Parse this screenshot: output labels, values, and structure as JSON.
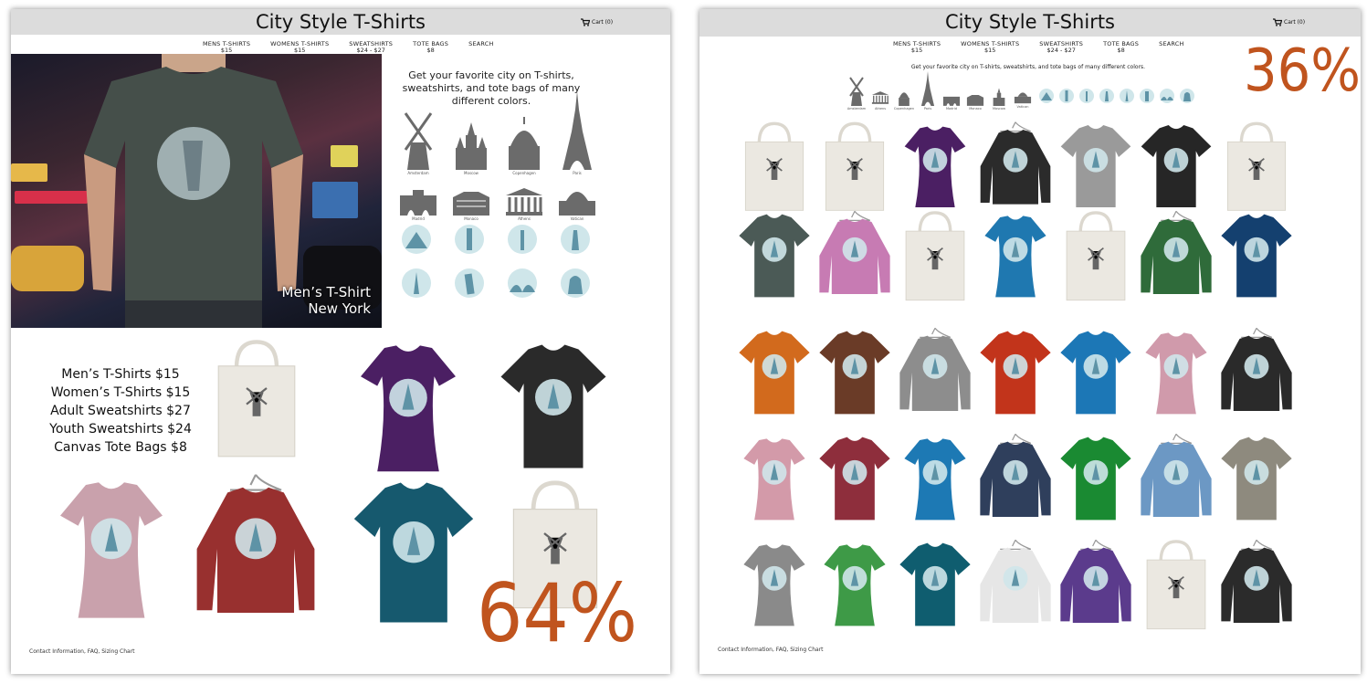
{
  "left": {
    "header": {
      "title": "City Style T-Shirts",
      "cart_label": "Cart (0)"
    },
    "nav": [
      {
        "label": "MENS T-SHIRTS",
        "price": "$15"
      },
      {
        "label": "WOMENS T-SHIRTS",
        "price": "$15"
      },
      {
        "label": "SWEATSHIRTS",
        "price": "$24 - $27"
      },
      {
        "label": "TOTE BAGS",
        "price": "$8"
      },
      {
        "label": "SEARCH",
        "price": ""
      }
    ],
    "hero": {
      "caption_line1": "Men’s T-Shirt",
      "caption_line2": "New York"
    },
    "intro": "Get your favorite city on T-shirts, sweatshirts, and tote bags of many different colors.",
    "city_icons": [
      "Amsterdam",
      "Moscow",
      "Copenhagen",
      "Paris",
      "Madrid",
      "Monaco",
      "Athens",
      "Vatican"
    ],
    "prices": [
      "Men’s T-Shirts $15",
      "Women’s T-Shirts $15",
      "Adult Sweatshirts $27",
      "Youth Sweatshirts $24",
      "Canvas Tote Bags $8"
    ],
    "products": [
      {
        "kind": "tote",
        "color": "#ebe8e1"
      },
      {
        "kind": "womens",
        "color": "#4b1f63"
      },
      {
        "kind": "tee",
        "color": "#2a2a2a"
      },
      {
        "kind": "womens",
        "color": "#c9a1ac"
      },
      {
        "kind": "sweat",
        "color": "#98302f"
      },
      {
        "kind": "tee",
        "color": "#16596e"
      },
      {
        "kind": "tote",
        "color": "#ebe8e1"
      }
    ],
    "percent": "64%",
    "footer": "Contact Information, FAQ, Sizing Chart"
  },
  "right": {
    "header": {
      "title": "City Style T-Shirts",
      "cart_label": "Cart (0)"
    },
    "nav": [
      {
        "label": "MENS T-SHIRTS",
        "price": "$15"
      },
      {
        "label": "WOMENS T-SHIRTS",
        "price": "$15"
      },
      {
        "label": "SWEATSHIRTS",
        "price": "$24 - $27"
      },
      {
        "label": "TOTE BAGS",
        "price": "$8"
      },
      {
        "label": "SEARCH",
        "price": ""
      }
    ],
    "intro": "Get your favorite city on T-shirts, sweatshirts, and tote bags of many different colors.",
    "city_icons": [
      "Amsterdam",
      "Athens",
      "Copenhagen",
      "Paris",
      "Madrid",
      "Monaco",
      "Moscow",
      "Vatican"
    ],
    "percent": "36%",
    "products": [
      {
        "kind": "tote",
        "color": "#ebe8e1"
      },
      {
        "kind": "tote",
        "color": "#ebe8e1"
      },
      {
        "kind": "womens",
        "color": "#4b1f63"
      },
      {
        "kind": "sweat",
        "color": "#2b2b2b"
      },
      {
        "kind": "tee",
        "color": "#9a9a9a"
      },
      {
        "kind": "tee",
        "color": "#262626"
      },
      {
        "kind": "tote",
        "color": "#ebe8e1"
      },
      {
        "kind": "tee",
        "color": "#4b5a56"
      },
      {
        "kind": "sweat",
        "color": "#c77bb3"
      },
      {
        "kind": "tote",
        "color": "#ebe8e1"
      },
      {
        "kind": "womens",
        "color": "#1f78b0"
      },
      {
        "kind": "tote",
        "color": "#ebe8e1"
      },
      {
        "kind": "sweat",
        "color": "#2f6b3a"
      },
      {
        "kind": "tee",
        "color": "#14406f"
      },
      {
        "kind": "tee",
        "color": "#d26a1d"
      },
      {
        "kind": "tee",
        "color": "#6a3b27"
      },
      {
        "kind": "sweat",
        "color": "#8d8d8d"
      },
      {
        "kind": "tee",
        "color": "#c2341b"
      },
      {
        "kind": "tee",
        "color": "#1c77b6"
      },
      {
        "kind": "womens",
        "color": "#d09aab"
      },
      {
        "kind": "sweat",
        "color": "#2a2a2a"
      },
      {
        "kind": "womens",
        "color": "#d39aa9"
      },
      {
        "kind": "tee",
        "color": "#8e2e3c"
      },
      {
        "kind": "womens",
        "color": "#1d79b4"
      },
      {
        "kind": "sweat",
        "color": "#2f3f5c"
      },
      {
        "kind": "tee",
        "color": "#1a8a32"
      },
      {
        "kind": "sweat",
        "color": "#6c98c4"
      },
      {
        "kind": "tee",
        "color": "#8e8a7e"
      },
      {
        "kind": "womens",
        "color": "#8a8a8a"
      },
      {
        "kind": "womens",
        "color": "#3e9a47"
      },
      {
        "kind": "tee",
        "color": "#0f5d6f"
      },
      {
        "kind": "sweat",
        "color": "#e6e6e6"
      },
      {
        "kind": "sweat",
        "color": "#5b3b8c"
      },
      {
        "kind": "tote",
        "color": "#ebe8e1"
      },
      {
        "kind": "sweat",
        "color": "#2b2b2b"
      }
    ],
    "footer": "Contact Information, FAQ, Sizing Chart"
  }
}
